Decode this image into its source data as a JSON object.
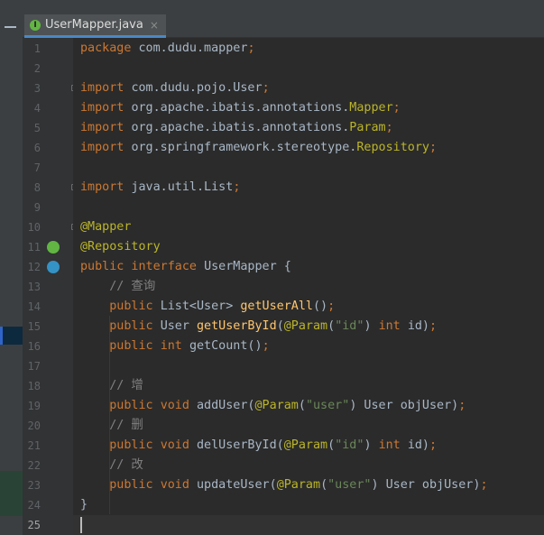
{
  "tab": {
    "icon_letter": "I",
    "title": "UserMapper.java",
    "close_glyph": "×"
  },
  "gutter": {
    "line_numbers": [
      "1",
      "2",
      "3",
      "4",
      "5",
      "6",
      "7",
      "8",
      "9",
      "10",
      "11",
      "12",
      "13",
      "14",
      "15",
      "16",
      "17",
      "18",
      "19",
      "20",
      "21",
      "22",
      "23",
      "24",
      "25"
    ],
    "current_line": 25,
    "fold_markers_at": [
      3,
      8,
      10
    ],
    "icons": [
      {
        "line": 11,
        "name": "spring-bean-icon",
        "color": "#62b543"
      },
      {
        "line": 12,
        "name": "implementations-icon",
        "color": "#3592c4"
      }
    ]
  },
  "code": {
    "lines": [
      [
        {
          "t": "package ",
          "c": "kw"
        },
        {
          "t": "com.dudu.mapper"
        },
        {
          "t": ";",
          "c": "kw"
        }
      ],
      [],
      [
        {
          "t": "import ",
          "c": "kw"
        },
        {
          "t": "com.dudu.pojo.User"
        },
        {
          "t": ";",
          "c": "kw"
        }
      ],
      [
        {
          "t": "import ",
          "c": "kw"
        },
        {
          "t": "org.apache.ibatis.annotations."
        },
        {
          "t": "Mapper",
          "c": "ann"
        },
        {
          "t": ";",
          "c": "kw"
        }
      ],
      [
        {
          "t": "import ",
          "c": "kw"
        },
        {
          "t": "org.apache.ibatis.annotations."
        },
        {
          "t": "Param",
          "c": "ann"
        },
        {
          "t": ";",
          "c": "kw"
        }
      ],
      [
        {
          "t": "import ",
          "c": "kw"
        },
        {
          "t": "org.springframework.stereotype."
        },
        {
          "t": "Repository",
          "c": "ann"
        },
        {
          "t": ";",
          "c": "kw"
        }
      ],
      [],
      [
        {
          "t": "import ",
          "c": "kw"
        },
        {
          "t": "java.util.List"
        },
        {
          "t": ";",
          "c": "kw"
        }
      ],
      [],
      [
        {
          "t": "@Mapper",
          "c": "ann"
        }
      ],
      [
        {
          "t": "@Repository",
          "c": "ann"
        }
      ],
      [
        {
          "t": "public interface ",
          "c": "kw"
        },
        {
          "t": "UserMapper {"
        }
      ],
      [
        {
          "t": "    // 查询",
          "c": "cmt"
        }
      ],
      [
        {
          "t": "    public ",
          "c": "kw"
        },
        {
          "t": "List<User> "
        },
        {
          "t": "getUserAll",
          "c": "fn"
        },
        {
          "t": "()"
        },
        {
          "t": ";",
          "c": "kw"
        }
      ],
      [
        {
          "t": "    public ",
          "c": "kw"
        },
        {
          "t": "User "
        },
        {
          "t": "getUserById",
          "c": "fn"
        },
        {
          "t": "("
        },
        {
          "t": "@Param",
          "c": "ann"
        },
        {
          "t": "("
        },
        {
          "t": "\"id\"",
          "c": "str"
        },
        {
          "t": ") "
        },
        {
          "t": "int ",
          "c": "kw"
        },
        {
          "t": "id)"
        },
        {
          "t": ";",
          "c": "kw"
        }
      ],
      [
        {
          "t": "    public ",
          "c": "kw"
        },
        {
          "t": "int ",
          "c": "kw"
        },
        {
          "t": "getCount()"
        },
        {
          "t": ";",
          "c": "kw"
        }
      ],
      [],
      [
        {
          "t": "    // 增",
          "c": "cmt"
        }
      ],
      [
        {
          "t": "    public ",
          "c": "kw"
        },
        {
          "t": "void ",
          "c": "kw"
        },
        {
          "t": "addUser("
        },
        {
          "t": "@Param",
          "c": "ann"
        },
        {
          "t": "("
        },
        {
          "t": "\"user\"",
          "c": "str"
        },
        {
          "t": ") User objUser)"
        },
        {
          "t": ";",
          "c": "kw"
        }
      ],
      [
        {
          "t": "    // 删",
          "c": "cmt"
        }
      ],
      [
        {
          "t": "    public ",
          "c": "kw"
        },
        {
          "t": "void ",
          "c": "kw"
        },
        {
          "t": "delUserById("
        },
        {
          "t": "@Param",
          "c": "ann"
        },
        {
          "t": "("
        },
        {
          "t": "\"id\"",
          "c": "str"
        },
        {
          "t": ") "
        },
        {
          "t": "int ",
          "c": "kw"
        },
        {
          "t": "id)"
        },
        {
          "t": ";",
          "c": "kw"
        }
      ],
      [
        {
          "t": "    // 改",
          "c": "cmt"
        }
      ],
      [
        {
          "t": "    public ",
          "c": "kw"
        },
        {
          "t": "void ",
          "c": "kw"
        },
        {
          "t": "updateUser("
        },
        {
          "t": "@Param",
          "c": "ann"
        },
        {
          "t": "("
        },
        {
          "t": "\"user\"",
          "c": "str"
        },
        {
          "t": ") User objUser)"
        },
        {
          "t": ";",
          "c": "kw"
        }
      ],
      [
        {
          "t": "}"
        }
      ],
      []
    ]
  },
  "colors": {
    "editor_bg": "#2b2b2b",
    "keyword": "#cc7832",
    "annotation": "#bbb529",
    "string": "#6a8759",
    "comment": "#808080",
    "method": "#ffc66d",
    "plain": "#a9b7c6"
  }
}
